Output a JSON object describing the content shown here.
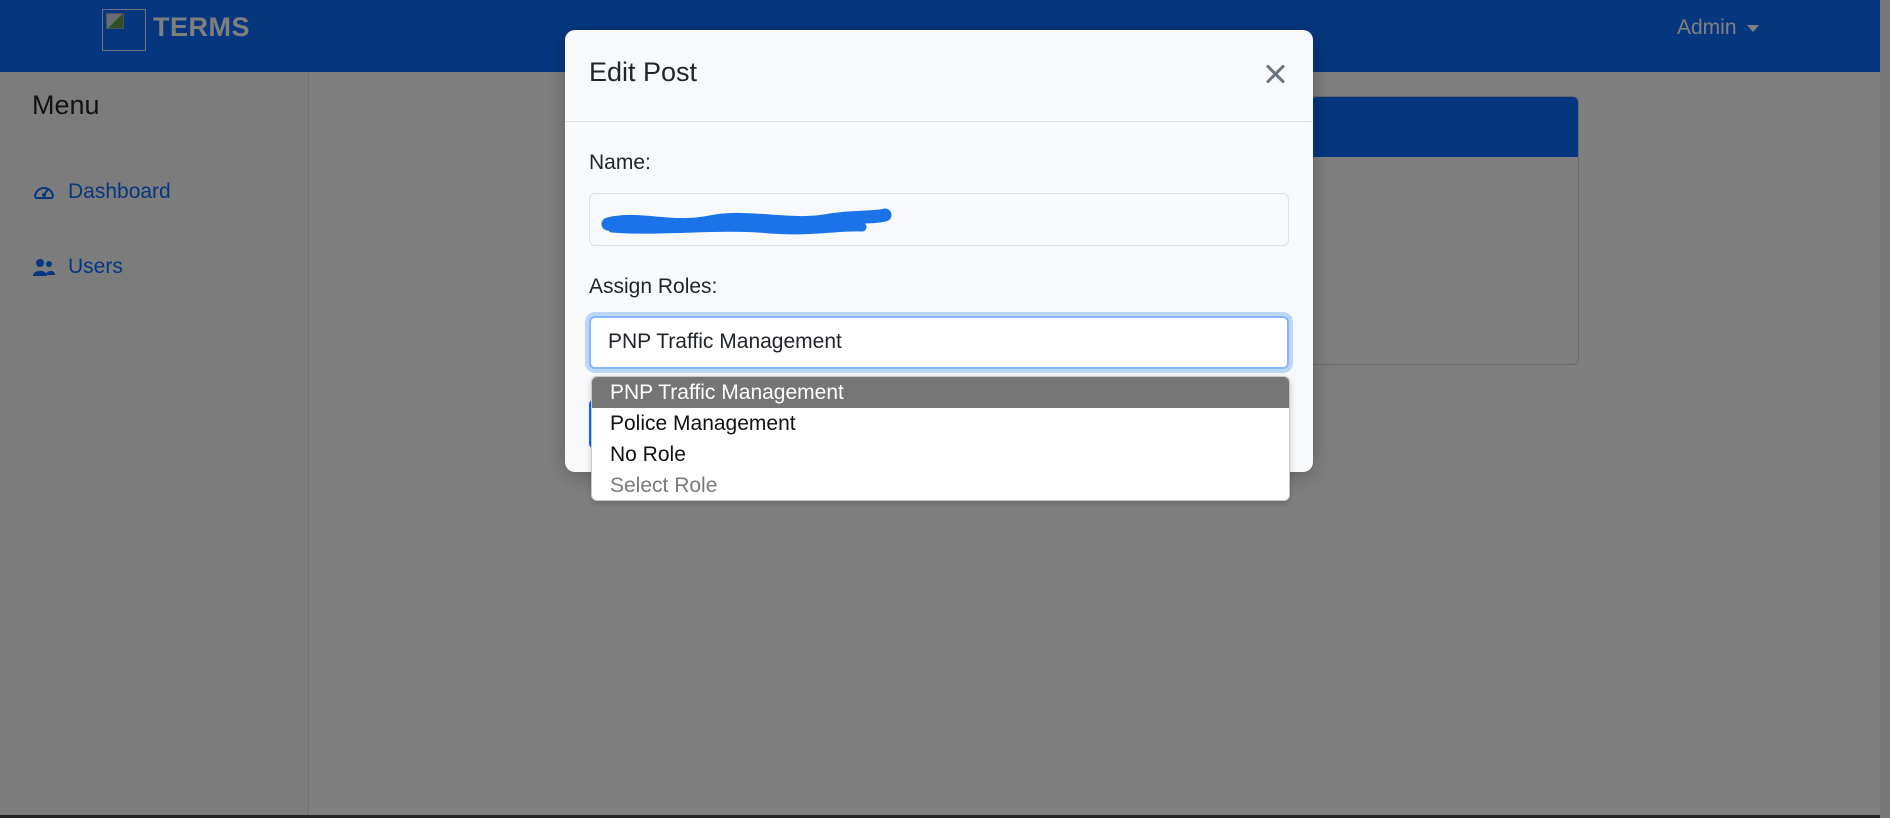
{
  "navbar": {
    "brand": "TERMS",
    "user_menu": "Admin"
  },
  "sidebar": {
    "title": "Menu",
    "items": [
      {
        "label": "Dashboard",
        "icon": "gauge-icon"
      },
      {
        "label": "Users",
        "icon": "users-icon"
      }
    ]
  },
  "modal": {
    "title": "Edit Post",
    "name_label": "Name:",
    "name_value": "",
    "roles_label": "Assign Roles:",
    "roles_selected": "PNP Traffic Management"
  },
  "dropdown": {
    "options": [
      {
        "label": "PNP Traffic Management",
        "selected": true
      },
      {
        "label": "Police Management",
        "selected": false
      },
      {
        "label": "No Role",
        "selected": false
      },
      {
        "label": "Select Role",
        "selected": false
      }
    ]
  },
  "colors": {
    "primary": "#0d6efd",
    "backdrop": "rgba(0,0,0,0.5)",
    "option_highlight": "#757575"
  }
}
